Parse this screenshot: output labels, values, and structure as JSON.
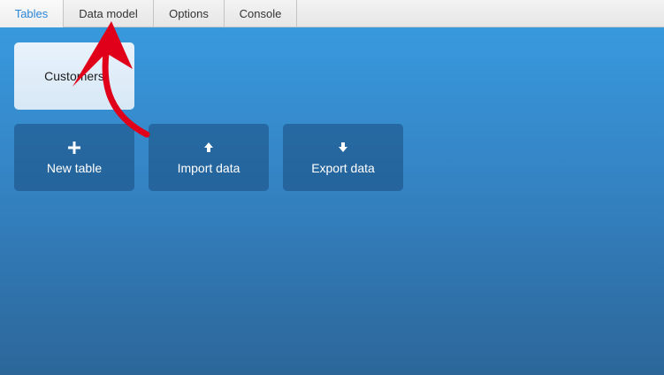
{
  "tabs": [
    {
      "label": "Tables",
      "active": true
    },
    {
      "label": "Data model",
      "active": false
    },
    {
      "label": "Options",
      "active": false
    },
    {
      "label": "Console",
      "active": false
    }
  ],
  "tables": [
    {
      "name": "Customers"
    }
  ],
  "actions": {
    "new_table": {
      "label": "New table",
      "icon": "plus-icon"
    },
    "import_data": {
      "label": "Import data",
      "icon": "arrow-up-icon"
    },
    "export_data": {
      "label": "Export data",
      "icon": "arrow-down-icon"
    }
  },
  "colors": {
    "active_tab": "#2b86d8",
    "annotation_arrow": "#e0001a"
  }
}
